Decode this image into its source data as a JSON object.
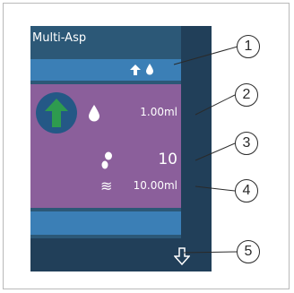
{
  "screen": {
    "title": "Multi-Asp",
    "volume": "1.00ml",
    "count": "10",
    "total": "10.00ml"
  },
  "icons": {
    "status": [
      "arrow-up-icon",
      "drop-icon"
    ],
    "main": [
      "go-button-icon",
      "drop-icon",
      "steps-icon",
      "wave-icon"
    ],
    "footer": [
      "arrow-down-icon"
    ]
  },
  "callouts": [
    "1",
    "2",
    "3",
    "4",
    "5"
  ],
  "colors": {
    "screen_bg": "#2c5877",
    "panel_dark": "#213f59",
    "bar_blue": "#3b7fb6",
    "purple": "#8b5f9b",
    "go_green": "#2e9b4f"
  }
}
